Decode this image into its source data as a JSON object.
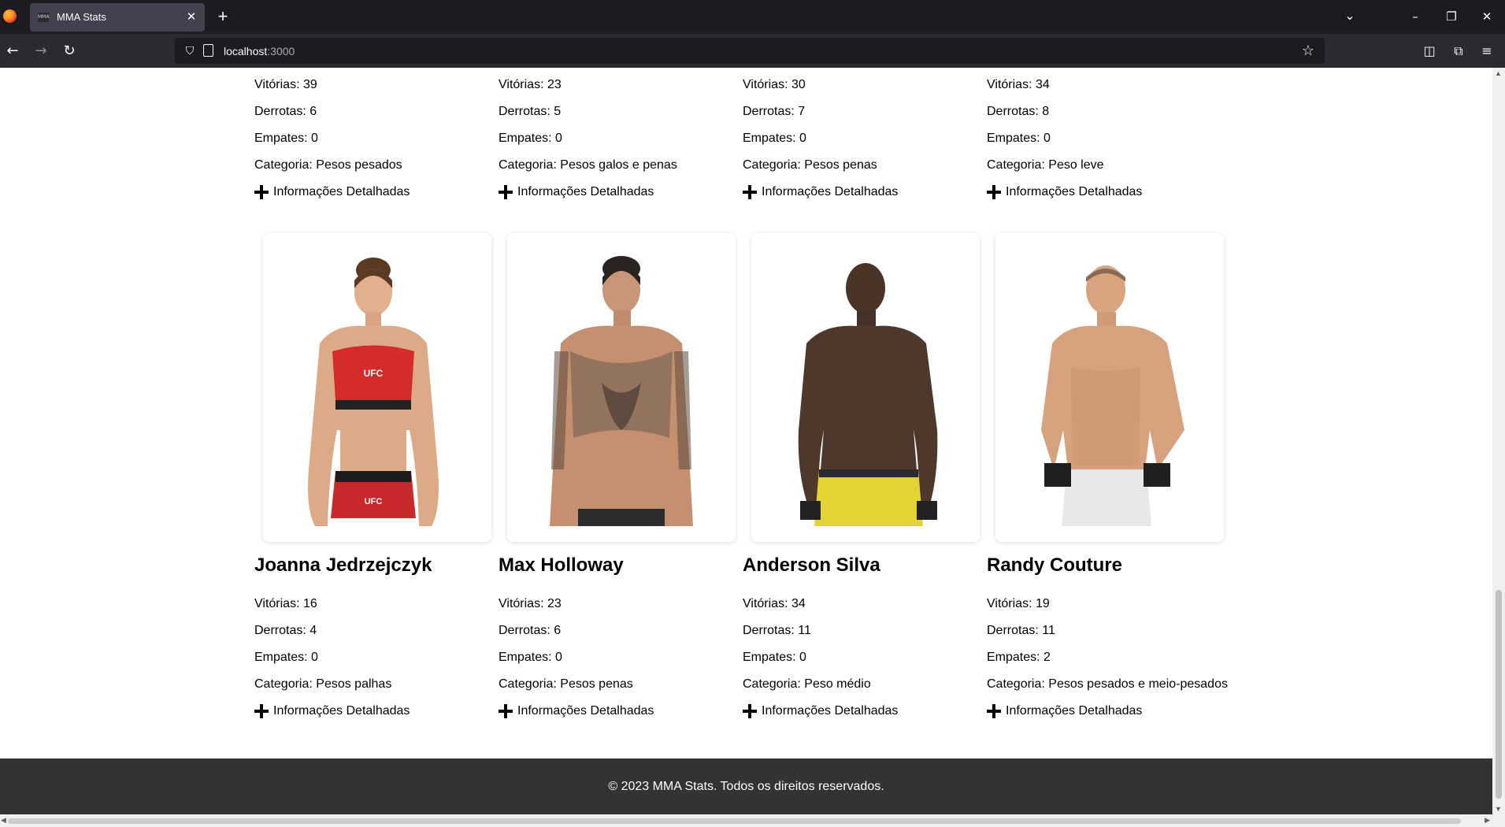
{
  "browser": {
    "tab_title": "MMA Stats",
    "tab_favicon_text": "MMA",
    "url_host": "localhost",
    "url_port": ":3000"
  },
  "top_row": [
    {
      "vitorias": "Vitórias: 39",
      "derrotas": "Derrotas: 6",
      "empates": "Empates: 0",
      "categoria": "Categoria: Pesos pesados",
      "info": "Informações Detalhadas"
    },
    {
      "vitorias": "Vitórias: 23",
      "derrotas": "Derrotas: 5",
      "empates": "Empates: 0",
      "categoria": "Categoria: Pesos galos e penas",
      "info": "Informações Detalhadas"
    },
    {
      "vitorias": "Vitórias: 30",
      "derrotas": "Derrotas: 7",
      "empates": "Empates: 0",
      "categoria": "Categoria: Pesos penas",
      "info": "Informações Detalhadas"
    },
    {
      "vitorias": "Vitórias: 34",
      "derrotas": "Derrotas: 8",
      "empates": "Empates: 0",
      "categoria": "Categoria: Peso leve",
      "info": "Informações Detalhadas"
    }
  ],
  "fighters": [
    {
      "name": "Joanna Jedrzejczyk",
      "vitorias": "Vitórias: 16",
      "derrotas": "Derrotas: 4",
      "empates": "Empates: 0",
      "categoria": "Categoria: Pesos palhas",
      "info": "Informações Detalhadas"
    },
    {
      "name": "Max Holloway",
      "vitorias": "Vitórias: 23",
      "derrotas": "Derrotas: 6",
      "empates": "Empates: 0",
      "categoria": "Categoria: Pesos penas",
      "info": "Informações Detalhadas"
    },
    {
      "name": "Anderson Silva",
      "vitorias": "Vitórias: 34",
      "derrotas": "Derrotas: 11",
      "empates": "Empates: 0",
      "categoria": "Categoria: Peso médio",
      "info": "Informações Detalhadas"
    },
    {
      "name": "Randy Couture",
      "vitorias": "Vitórias: 19",
      "derrotas": "Derrotas: 11",
      "empates": "Empates: 2",
      "categoria": "Categoria: Pesos pesados e meio-pesados",
      "info": "Informações Detalhadas"
    }
  ],
  "footer": {
    "text": "© 2023 MMA Stats. Todos os direitos reservados."
  }
}
